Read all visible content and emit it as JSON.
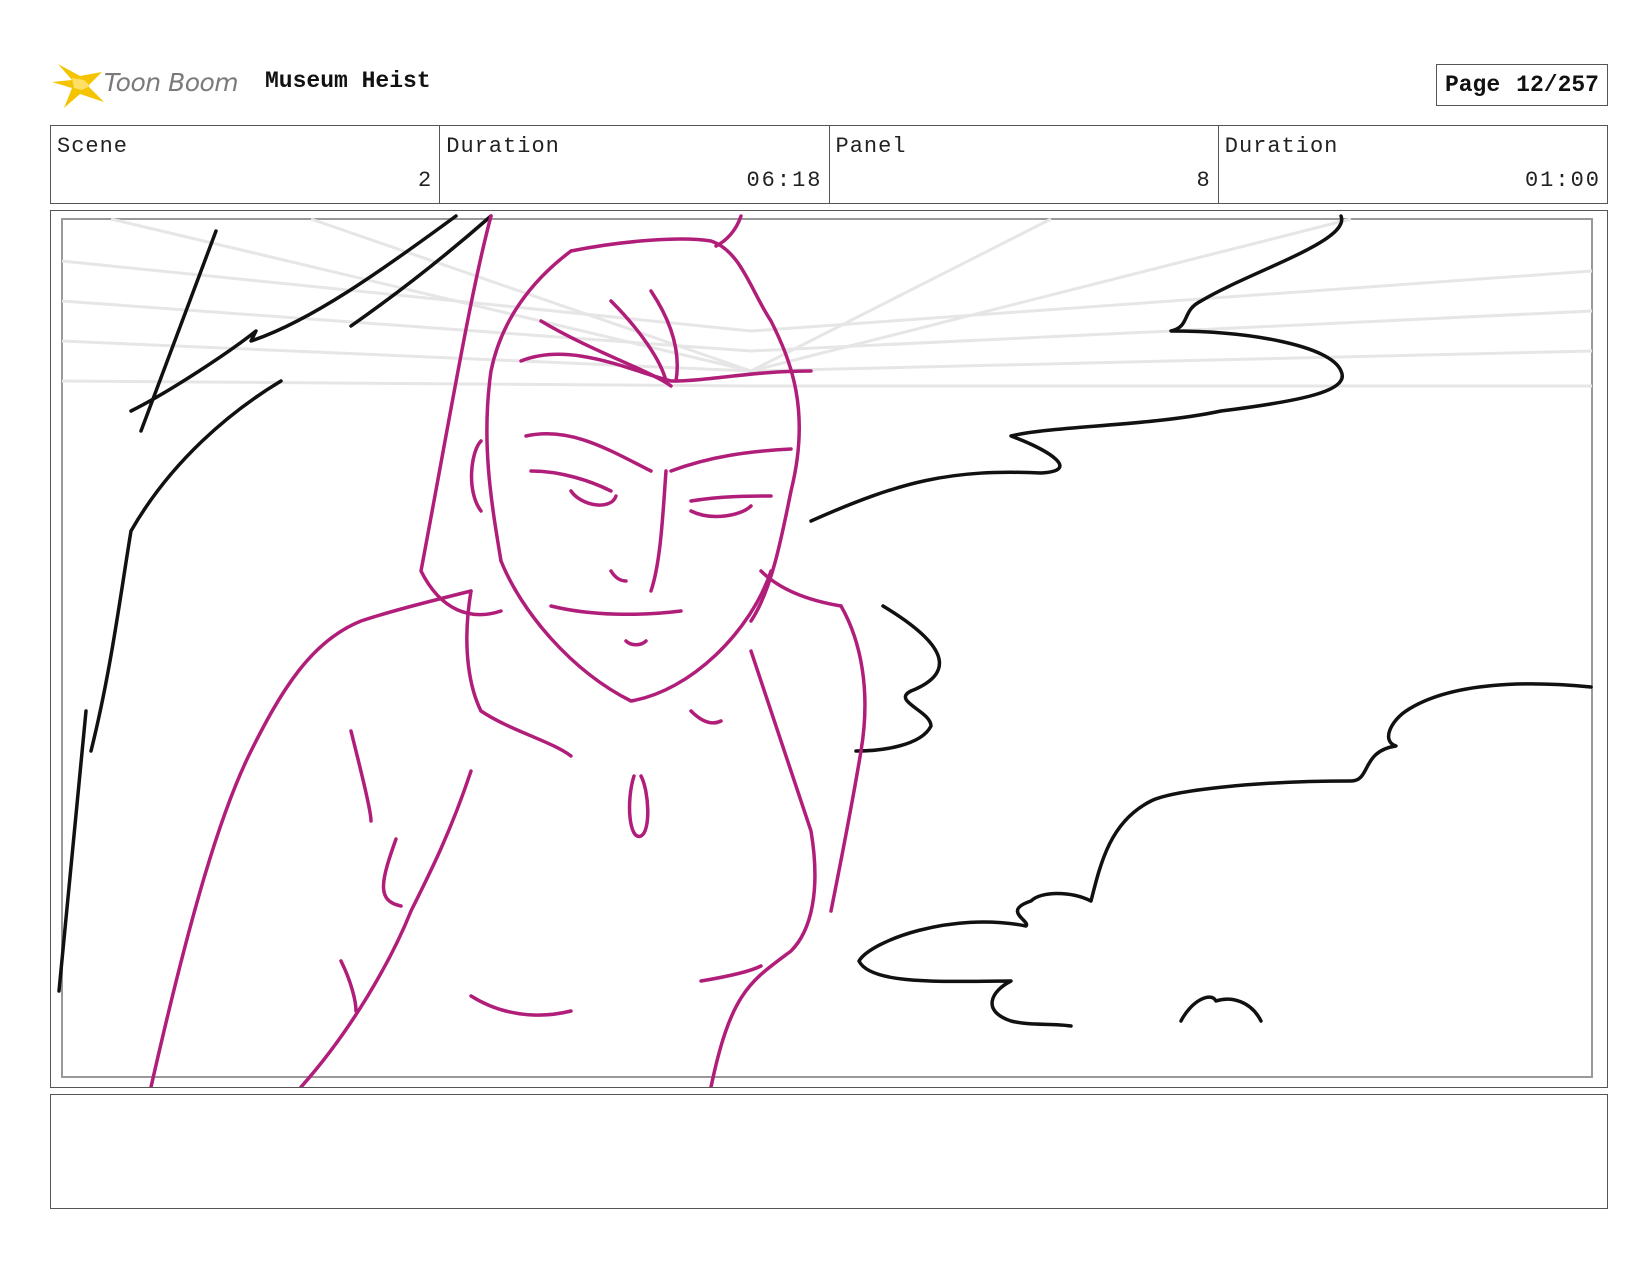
{
  "header": {
    "brand_name": "Toon Boom",
    "project_title": "Museum Heist",
    "page_label": "Page",
    "page_value": "12/257"
  },
  "info": {
    "scene_label": "Scene",
    "scene_value": "2",
    "scene_duration_label": "Duration",
    "scene_duration_value": "06:18",
    "panel_label": "Panel",
    "panel_value": "8",
    "panel_duration_label": "Duration",
    "panel_duration_value": "01:00"
  },
  "colors": {
    "character_line": "#b01e7a",
    "background_line": "#111111",
    "logo_yellow": "#f5c400"
  },
  "notes": {
    "text": ""
  }
}
